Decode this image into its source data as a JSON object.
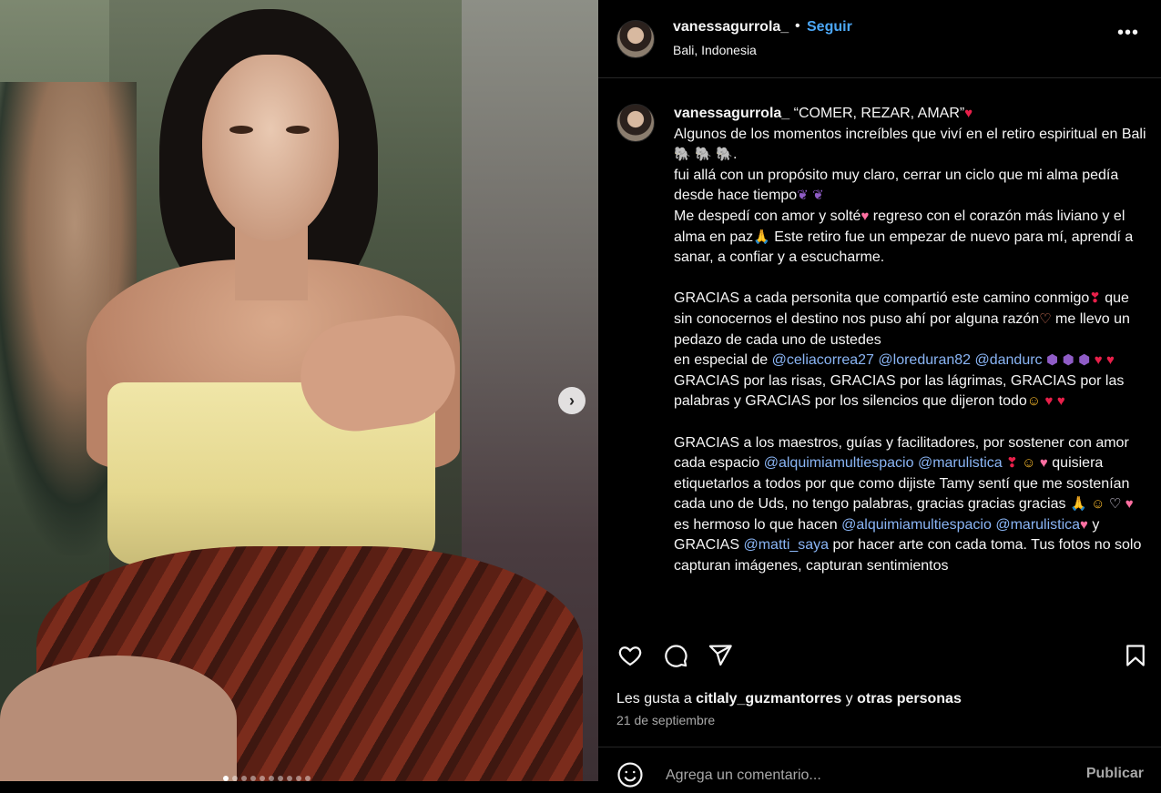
{
  "post": {
    "username": "vanessagurrola_",
    "dot": "•",
    "follow_label": "Seguir",
    "location": "Bali, Indonesia",
    "more_label": "•••"
  },
  "media": {
    "next_glyph": "›",
    "current_slide": 1,
    "slide_count": 10
  },
  "caption": {
    "username": "vanessagurrola_",
    "title": "“COMER, REZAR, AMAR”",
    "line1": "Algunos de los momentos increíbles que viví en el retiro espiritual en Bali",
    "line1_end": ".",
    "line2": "fui allá con un propósito muy claro, cerrar un ciclo que mi alma pedía desde hace tiempo",
    "line3a": "Me despedí con amor y solté",
    "line3b": " regreso con el corazón más liviano y el alma en paz",
    "line3c": " Este retiro fue un empezar de nuevo para mí, aprendí a sanar, a confiar y a escucharme.",
    "line4a": "GRACIAS a cada personita que compartió este camino conmigo",
    "line4b": " que sin conocernos el destino nos puso ahí por alguna razón",
    "line4c": " me llevo un pedazo de cada uno de ustedes",
    "line4d": "en especial de ",
    "mention1": "@celiacorrea27",
    "mention2": "@loreduran82",
    "mention3": "@dandurc",
    "line5": "GRACIAS por las risas, GRACIAS por las lágrimas, GRACIAS por las palabras y GRACIAS por los silencios que dijeron todo",
    "line6a": "GRACIAS a los maestros, guías y facilitadores, por sostener con amor cada espacio ",
    "mention4": "@alquimiamultiespacio",
    "mention5": "@marulistica",
    "line6b": " quisiera etiquetarlos a todos por que como dijiste Tamy sentí que me sostenían cada uno de Uds, no tengo palabras, gracias gracias gracias ",
    "line6c": " es hermoso lo que hacen ",
    "mention6": "@alquimiamultiespacio",
    "mention7": "@marulistica",
    "line6d": " y GRACIAS ",
    "mention8": "@matti_saya",
    "line6e": " por hacer arte con cada toma. Tus fotos no solo capturan imágenes, capturan sentimientos"
  },
  "emoji": {
    "heart": "♥",
    "elephant": "🐘",
    "wing": "❦",
    "hands": "🙏",
    "hands_heart": "♡",
    "crystal": "⬢",
    "pleading": "☺",
    "kiss": "😘",
    "white_heart": "♡",
    "exclam_heart": "❣"
  },
  "actions": {
    "like_icon": "heart-outline-icon",
    "comment_icon": "comment-bubble-icon",
    "share_icon": "paper-plane-icon",
    "save_icon": "bookmark-icon"
  },
  "likes": {
    "prefix": "Les gusta a ",
    "user": "citlaly_guzmantorres",
    "middle": " y ",
    "suffix": "otras personas"
  },
  "date": "21 de septiembre",
  "comment": {
    "placeholder": "Agrega un comentario...",
    "publish_label": "Publicar"
  }
}
